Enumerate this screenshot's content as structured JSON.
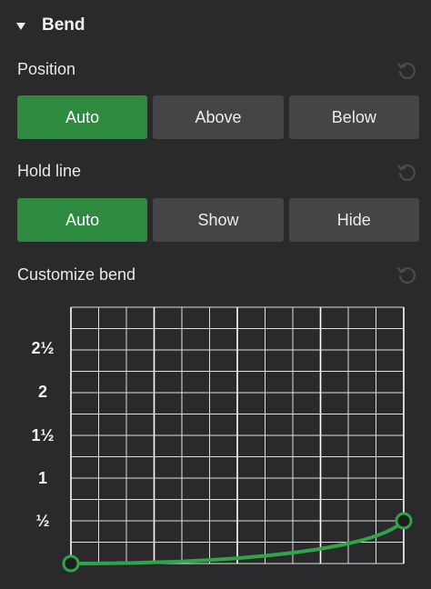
{
  "section": {
    "title": "Bend"
  },
  "position": {
    "label": "Position",
    "options": [
      "Auto",
      "Above",
      "Below"
    ],
    "selected": "Auto"
  },
  "hold_line": {
    "label": "Hold line",
    "options": [
      "Auto",
      "Show",
      "Hide"
    ],
    "selected": "Auto"
  },
  "customize": {
    "label": "Customize bend",
    "y_labels": [
      "2½",
      "2",
      "1½",
      "1",
      "½"
    ],
    "curve": {
      "start_value": 0,
      "end_value": 0.5
    }
  },
  "colors": {
    "accent": "#2e8a3e",
    "curve": "#2fa54a",
    "button": "#454547",
    "background": "#2a2a2c"
  },
  "icons": {
    "reset": "reset-icon",
    "collapse": "triangle-down-icon"
  }
}
